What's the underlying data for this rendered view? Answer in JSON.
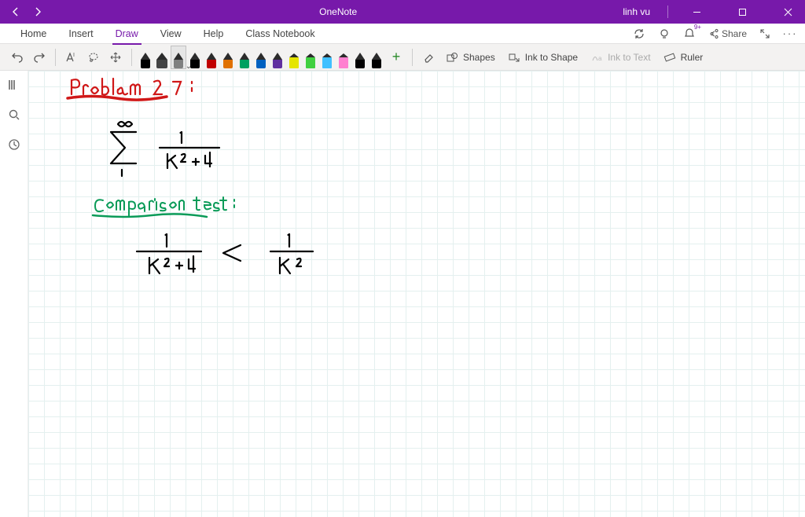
{
  "titlebar": {
    "app": "OneNote",
    "user": "linh vu"
  },
  "menu": {
    "tabs": [
      "Home",
      "Insert",
      "Draw",
      "View",
      "Help",
      "Class Notebook"
    ],
    "active": 2,
    "share": "Share",
    "notif_badge": "9+"
  },
  "ribbon": {
    "pens": [
      {
        "color": "#000000",
        "type": "pen",
        "selected": false
      },
      {
        "color": "#444444",
        "type": "pen",
        "selected": false,
        "thick": true
      },
      {
        "color": "#808080",
        "type": "pen",
        "selected": true
      },
      {
        "color": "#000000",
        "type": "pen",
        "selected": false
      },
      {
        "color": "#c00000",
        "type": "pen",
        "selected": false
      },
      {
        "color": "#e07000",
        "type": "pen",
        "selected": false
      },
      {
        "color": "#00a060",
        "type": "pen",
        "selected": false
      },
      {
        "color": "#0060c0",
        "type": "pen",
        "selected": false
      },
      {
        "color": "#6030a0",
        "type": "pen",
        "selected": false
      },
      {
        "color": "#e5e500",
        "type": "hl",
        "selected": false
      },
      {
        "color": "#40d040",
        "type": "hl",
        "selected": false
      },
      {
        "color": "#40c0ff",
        "type": "hl",
        "selected": false
      },
      {
        "color": "#ff80d0",
        "type": "hl",
        "selected": false
      },
      {
        "color": "#000000",
        "type": "pen",
        "selected": false
      },
      {
        "color": "#000000",
        "type": "pen",
        "selected": false
      }
    ],
    "shapes": "Shapes",
    "inkToShape": "Ink to Shape",
    "inkToText": "Ink to Text",
    "ruler": "Ruler"
  },
  "ink": {
    "title": "Problem 27",
    "subtitle": "Comparison test",
    "formula_top": "Σ (k=1..∞) 1 / (k² + 4)",
    "formula_bottom": "1 / (k² + 4)  <  1 / k²",
    "colors": {
      "red": "#d01818",
      "green": "#0a9b58",
      "black": "#000000"
    }
  }
}
